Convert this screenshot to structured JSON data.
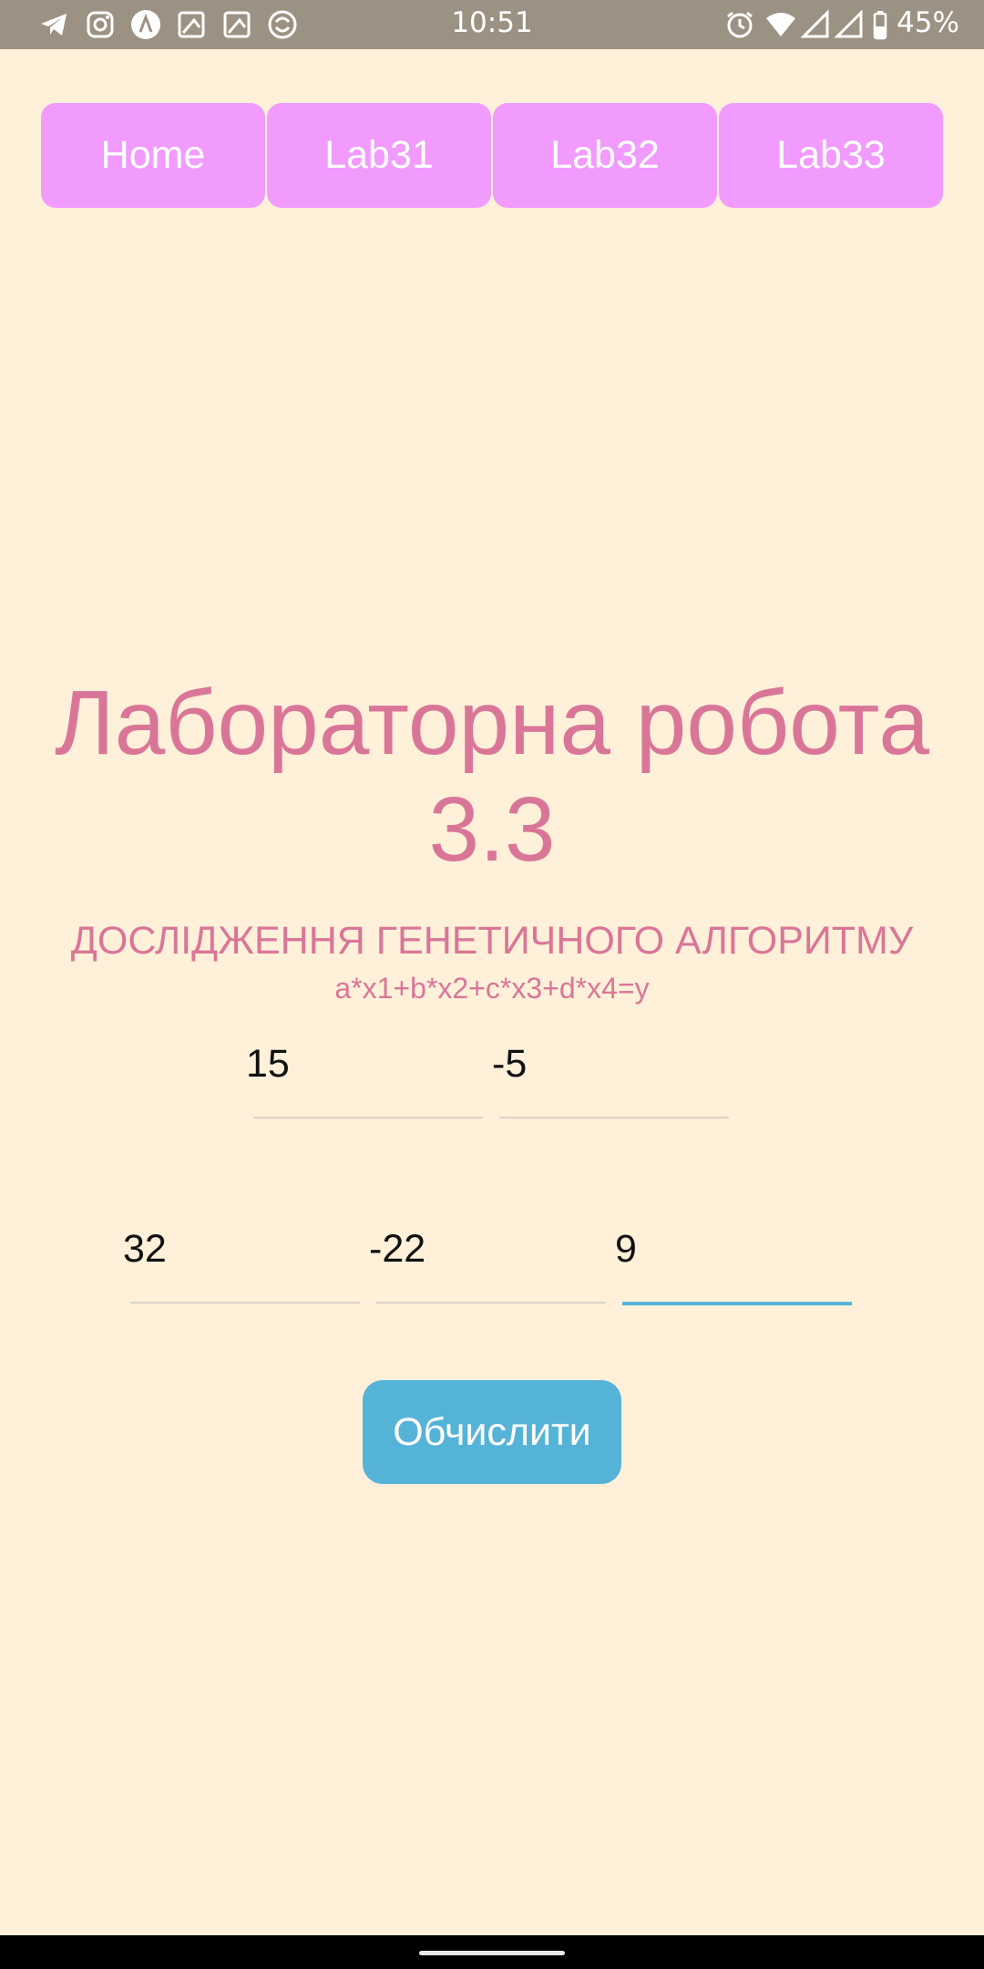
{
  "status_bar": {
    "time": "10:51",
    "battery": "45%",
    "left_icons": [
      "telegram-icon",
      "instagram-icon",
      "app-launcher-icon",
      "image-icon",
      "image-icon",
      "sync-icon"
    ],
    "right_icons": [
      "alarm-icon",
      "wifi-icon",
      "signal-icon",
      "signal-icon",
      "battery-icon"
    ]
  },
  "tabs": [
    {
      "label": "Home"
    },
    {
      "label": "Lab31"
    },
    {
      "label": "Lab32"
    },
    {
      "label": "Lab33"
    }
  ],
  "main": {
    "title": "Лабораторна робота 3.3",
    "subtitle": "ДОСЛІДЖЕННЯ ГЕНЕТИЧНОГО АЛГОРИТМУ",
    "formula": "a*x1+b*x2+c*x3+d*x4=y",
    "row1": [
      {
        "value": "15"
      },
      {
        "value": "-5"
      }
    ],
    "row2": [
      {
        "value": "32"
      },
      {
        "value": "-22"
      },
      {
        "value": "9"
      }
    ],
    "calculate_label": "Обчислити"
  },
  "colors": {
    "background": "#fff0d9",
    "tab": "#f29bff",
    "accent_text": "#d97698",
    "button": "#56b3d8"
  }
}
